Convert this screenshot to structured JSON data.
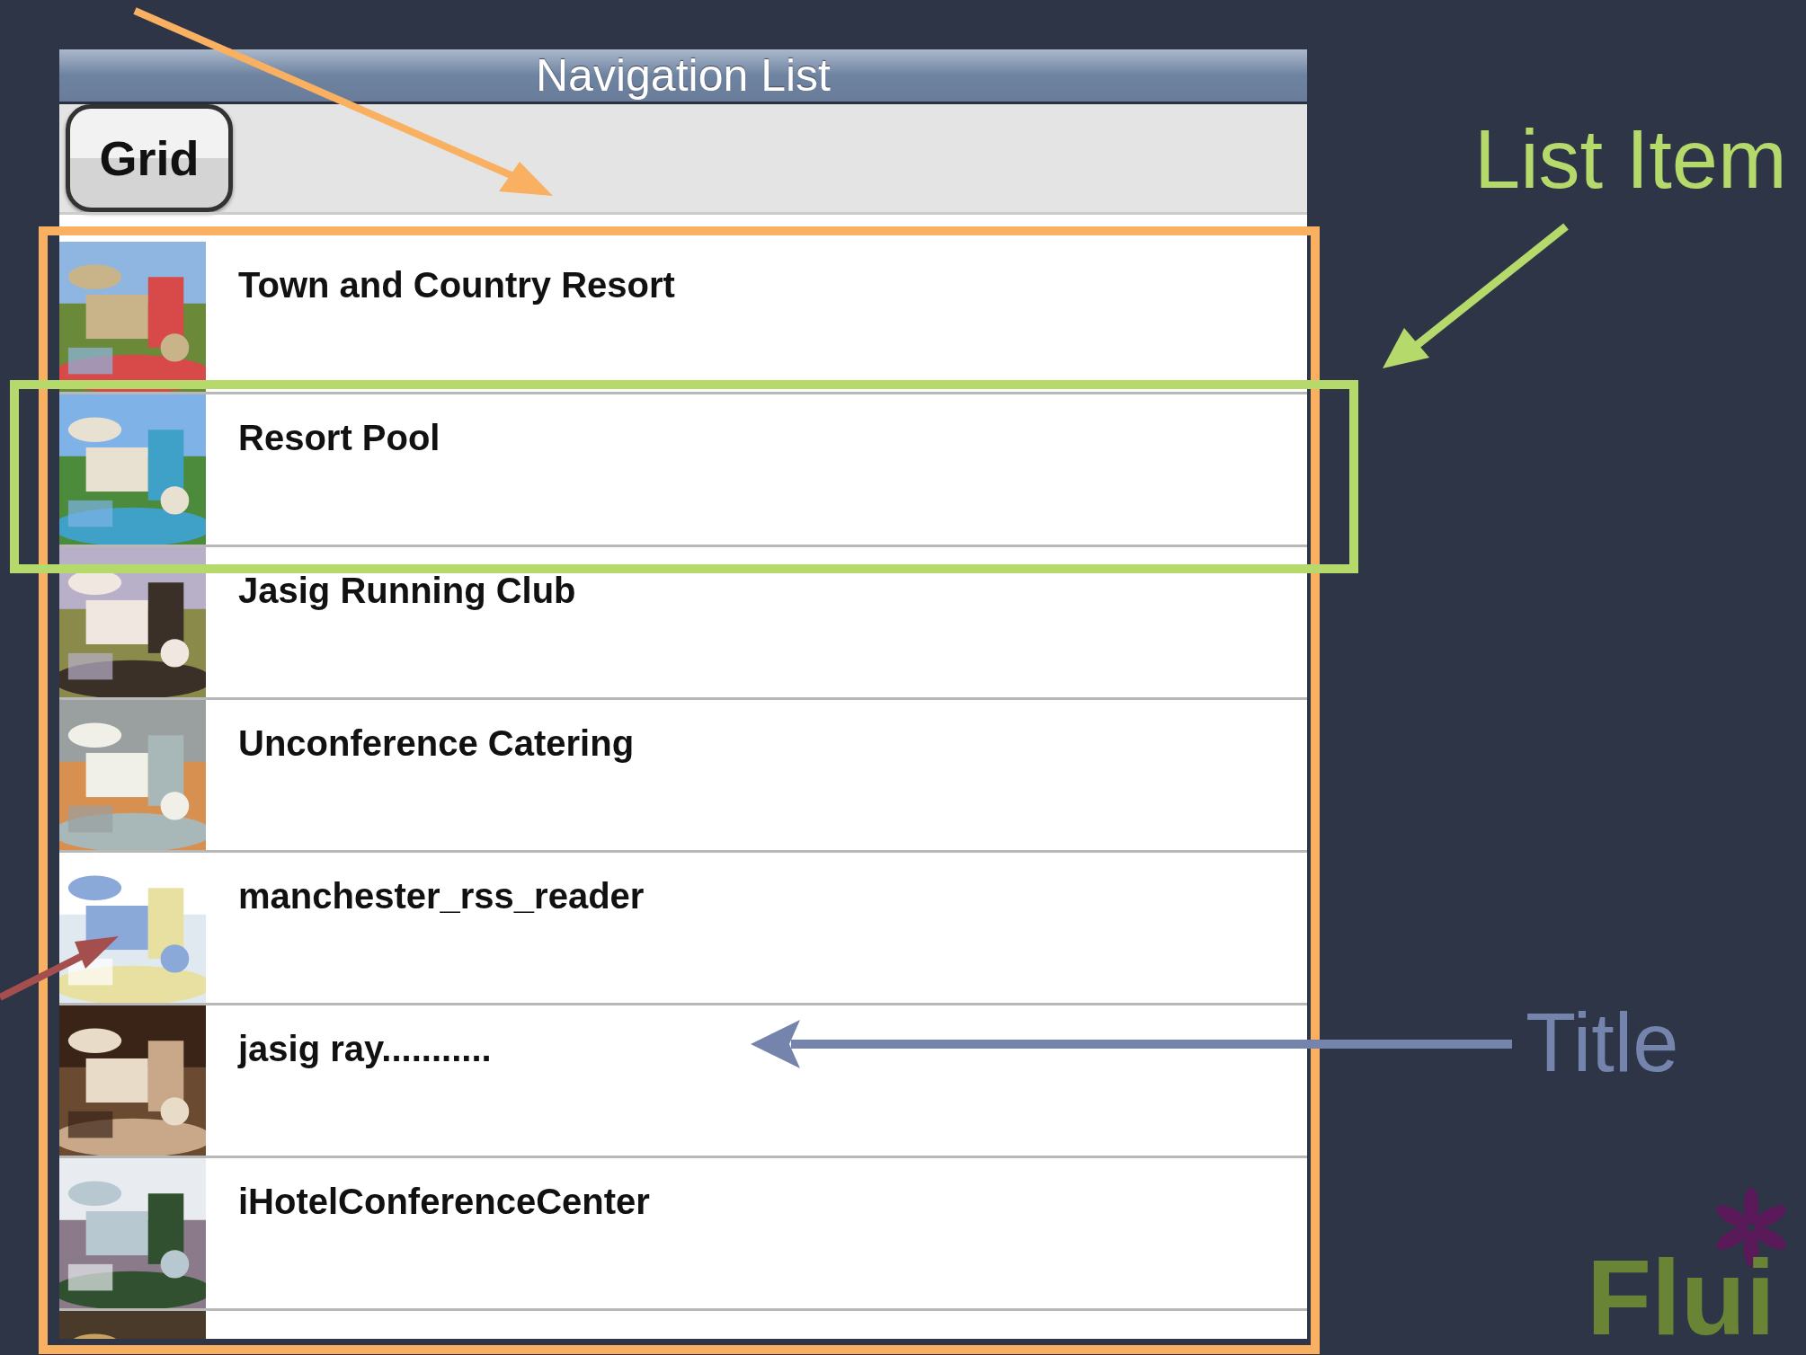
{
  "screen": {
    "title": "Navigation List",
    "toolbar": {
      "button": "Grid"
    },
    "rows": [
      {
        "title": "Town and Country Resort",
        "thumbnail": {
          "kind": "picture"
        }
      },
      {
        "title": "Resort Pool",
        "thumbnail": {
          "kind": "picture"
        }
      },
      {
        "title": "Jasig Running Club",
        "thumbnail": {
          "kind": "picture"
        }
      },
      {
        "title": "Unconference Catering",
        "thumbnail": {
          "kind": "picture"
        }
      },
      {
        "title": "manchester_rss_reader",
        "thumbnail": {
          "kind": "picture"
        }
      },
      {
        "title": "jasig ray...........",
        "thumbnail": {
          "kind": "picture"
        }
      },
      {
        "title": "iHotelConferenceCenter",
        "thumbnail": {
          "kind": "picture"
        }
      },
      {
        "thumbnail": {
          "kind": "picture"
        }
      }
    ]
  },
  "annotations": [
    {
      "label": "List Item",
      "color": "#b5d96b"
    },
    {
      "label": "Title",
      "color": "#7484ac"
    }
  ],
  "logo": {
    "text": "Flui"
  }
}
